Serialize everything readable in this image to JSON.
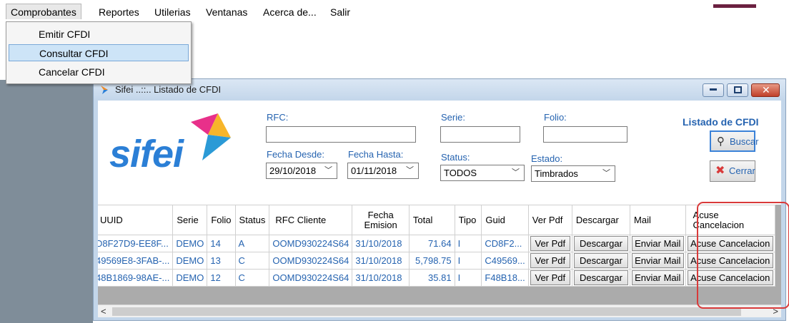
{
  "menubar": {
    "items": [
      "Comprobantes",
      "Reportes",
      "Utilerias",
      "Ventanas",
      "Acerca de...",
      "Salir"
    ]
  },
  "dropdown": {
    "items": [
      "Emitir CFDI",
      "Consultar CFDI",
      "Cancelar CFDI"
    ]
  },
  "window": {
    "title": "Sifei ..::.. Listado de CFDI",
    "controls": [
      "minimize-icon",
      "maximize-icon",
      "close-icon"
    ]
  },
  "form": {
    "logo": "sifei",
    "heading": "Listado de CFDI",
    "rfc_label": "RFC:",
    "rfc_value": "",
    "serie_label": "Serie:",
    "serie_value": "",
    "folio_label": "Folio:",
    "folio_value": "",
    "fecha_desde_label": "Fecha Desde:",
    "fecha_desde_value": "29/10/2018",
    "fecha_hasta_label": "Fecha Hasta:",
    "fecha_hasta_value": "01/11/2018",
    "status_label": "Status:",
    "status_value": "TODOS",
    "estado_label": "Estado:",
    "estado_value": "Timbrados",
    "buscar_label": "Buscar",
    "cerrar_label": "Cerrar"
  },
  "grid": {
    "columns": [
      "UUID",
      "Serie",
      "Folio",
      "Status",
      "RFC Cliente",
      "Fecha Emision",
      "Total",
      "Tipo",
      "Guid",
      "Ver Pdf",
      "Descargar",
      "Mail",
      "Acuse Cancelacion"
    ],
    "rows": [
      {
        "uuid": "D8F27D9-EE8F...",
        "serie": "DEMO",
        "folio": "14",
        "status": "A",
        "rfc": "OOMD930224S64",
        "fecha": "31/10/2018",
        "total": "71.64",
        "tipo": "I",
        "guid": "CD8F2...",
        "ver_pdf": "Ver Pdf",
        "descargar": "Descargar",
        "mail": "Enviar Mail",
        "acuse": "Acuse Cancelacion"
      },
      {
        "uuid": "49569E8-3FAB-...",
        "serie": "DEMO",
        "folio": "13",
        "status": "C",
        "rfc": "OOMD930224S64",
        "fecha": "31/10/2018",
        "total": "5,798.75",
        "tipo": "I",
        "guid": "C49569...",
        "ver_pdf": "Ver Pdf",
        "descargar": "Descargar",
        "mail": "Enviar Mail",
        "acuse": "Acuse Cancelacion"
      },
      {
        "uuid": "48B1869-98AE-...",
        "serie": "DEMO",
        "folio": "12",
        "status": "C",
        "rfc": "OOMD930224S64",
        "fecha": "31/10/2018",
        "total": "35.81",
        "tipo": "I",
        "guid": "F48B18...",
        "ver_pdf": "Ver Pdf",
        "descargar": "Descargar",
        "mail": "Enviar Mail",
        "acuse": "Acuse Cancelacion"
      }
    ],
    "scroll_left": "<",
    "scroll_right": ">"
  },
  "colors": {
    "accent_blue": "#2563b0",
    "highlight_red": "#d93a3a",
    "logo_blue": "#2b7fd6"
  }
}
